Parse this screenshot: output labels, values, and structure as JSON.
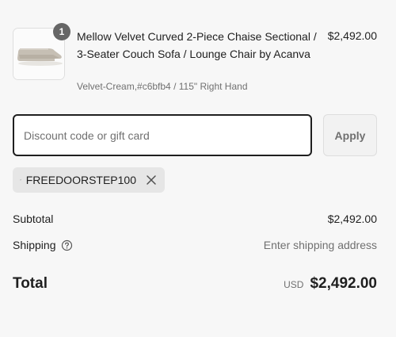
{
  "cart": {
    "item": {
      "quantity": "1",
      "title": "Mellow Velvet Curved 2-Piece Chaise Sectional / 3-Seater Couch Sofa / Lounge Chair by Acanva",
      "variant": "Velvet-Cream,#c6bfb4 / 115\" Right Hand",
      "price": "$2,492.00",
      "image_icon": "sofa-thumbnail"
    }
  },
  "discount": {
    "placeholder": "Discount code or gift card",
    "value": "",
    "apply_label": "Apply",
    "applied_code": "FREEDOORSTEP100",
    "tag_icon": "tag-icon",
    "remove_icon": "close-icon"
  },
  "summary": {
    "subtotal_label": "Subtotal",
    "subtotal_value": "$2,492.00",
    "shipping_label": "Shipping",
    "shipping_help_icon": "question-circle-icon",
    "shipping_value": "Enter shipping address",
    "total_label": "Total",
    "currency": "USD",
    "total_value": "$2,492.00"
  },
  "colors": {
    "background": "#f7f7f7",
    "text": "#1f1f1f",
    "muted": "#707070",
    "badge": "#666666",
    "sofa": "#c6bfb4"
  }
}
